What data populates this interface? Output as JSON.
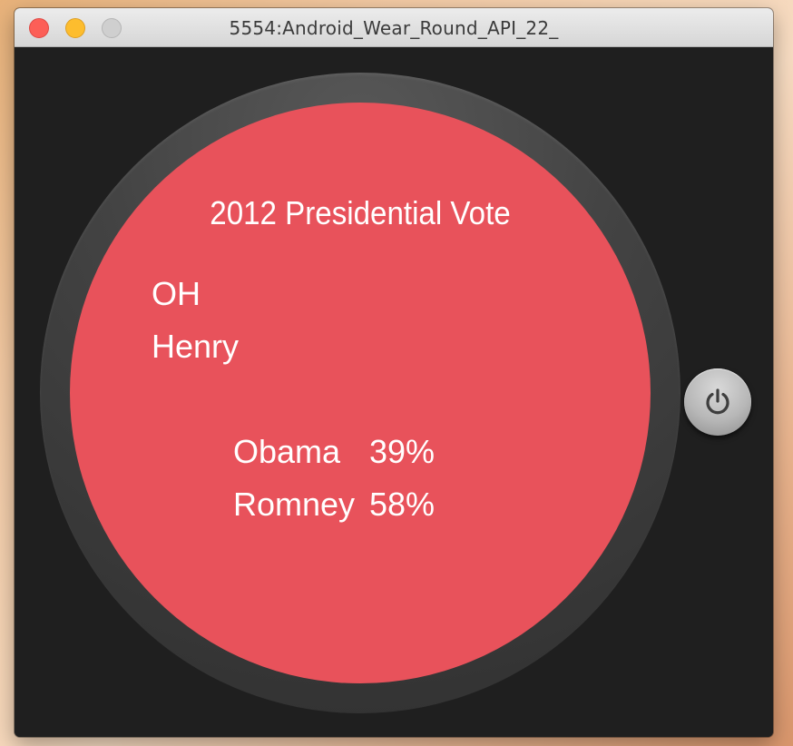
{
  "window": {
    "title": "5554:Android_Wear_Round_API_22_"
  },
  "watch": {
    "screen_color": "#e8525b",
    "heading": "2012 Presidential Vote",
    "state": "OH",
    "county": "Henry",
    "results": [
      {
        "candidate": "Obama",
        "percent": "39%"
      },
      {
        "candidate": "Romney",
        "percent": "58%"
      }
    ]
  },
  "icons": {
    "power": "power-icon"
  }
}
